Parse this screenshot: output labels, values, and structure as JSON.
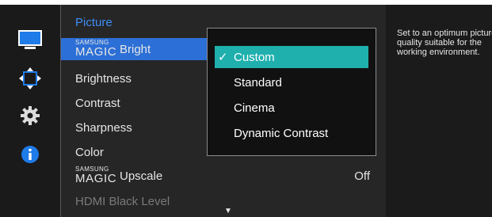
{
  "sidebar": {
    "icons": [
      "monitor-icon",
      "move-arrows-icon",
      "gear-icon",
      "info-icon"
    ]
  },
  "menu": {
    "title": "Picture",
    "items": [
      {
        "brand_top": "SAMSUNG",
        "brand_bottom": "MAGIC",
        "label": "Bright"
      },
      {
        "label": "Brightness"
      },
      {
        "label": "Contrast"
      },
      {
        "label": "Sharpness"
      },
      {
        "label": "Color"
      },
      {
        "brand_top": "SAMSUNG",
        "brand_bottom": "MAGIC",
        "label": "Upscale",
        "value": "Off"
      },
      {
        "label": "HDMI Black Level"
      }
    ],
    "scroll_indicator": "▼"
  },
  "dropdown": {
    "check_mark": "✓",
    "options": [
      {
        "label": "Custom"
      },
      {
        "label": "Standard"
      },
      {
        "label": "Cinema"
      },
      {
        "label": "Dynamic Contrast"
      }
    ]
  },
  "help": {
    "text": "Set to an optimum picture quality suitable for the working environment."
  },
  "colors": {
    "menu_title": "#3e8ef7",
    "selected_item": "#2c6fd6",
    "selected_option": "#1fb0ae"
  }
}
